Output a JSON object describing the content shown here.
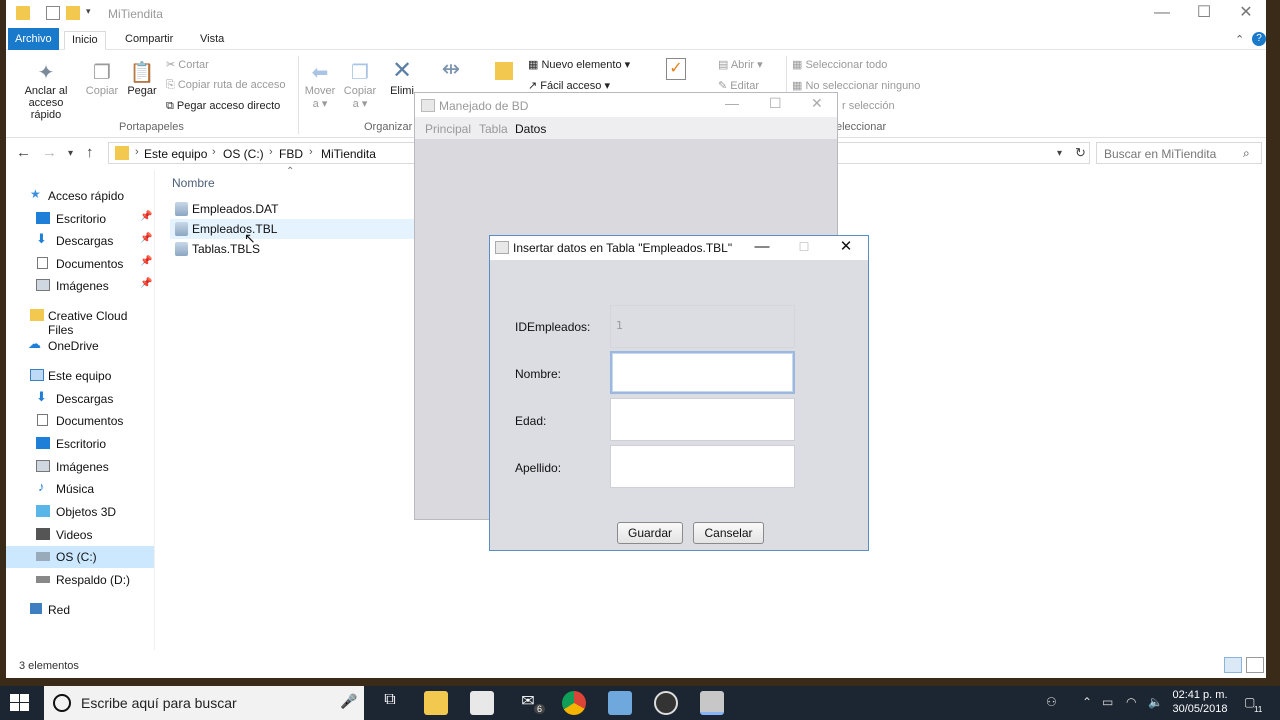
{
  "explorer": {
    "title": "MiTiendita",
    "tabs": [
      "Archivo",
      "Inicio",
      "Compartir",
      "Vista"
    ],
    "ribbon": {
      "pin_label_1": "Anclar al",
      "pin_label_2": "acceso rápido",
      "copy": "Copiar",
      "paste": "Pegar",
      "cut": "Cortar",
      "copy_path": "Copiar ruta de acceso",
      "paste_shortcut": "Pegar acceso directo",
      "group_clipboard": "Portapapeles",
      "move_1": "Mover",
      "move_2": "a ▾",
      "copy_to_1": "Copiar",
      "copy_to_2": "a ▾",
      "delete": "Elimi",
      "group_organize": "Organizar",
      "new_item": "Nuevo elemento ▾",
      "easy_access": "Fácil acceso ▾",
      "open": "Abrir ▾",
      "edit": "Editar",
      "select_all": "Seleccionar todo",
      "select_none": "No seleccionar ninguno",
      "invert_selection": "r selección",
      "group_select": "eleccionar"
    },
    "breadcrumb": [
      "Este equipo",
      "OS (C:)",
      "FBD",
      "MiTiendita"
    ],
    "search_placeholder": "Buscar en MiTiendita",
    "nav": [
      {
        "label": "Acceso rápido"
      },
      {
        "label": "Escritorio"
      },
      {
        "label": "Descargas"
      },
      {
        "label": "Documentos"
      },
      {
        "label": "Imágenes"
      },
      {
        "label": "Creative Cloud Files"
      },
      {
        "label": "OneDrive"
      },
      {
        "label": "Este equipo"
      },
      {
        "label": "Descargas"
      },
      {
        "label": "Documentos"
      },
      {
        "label": "Escritorio"
      },
      {
        "label": "Imágenes"
      },
      {
        "label": "Música"
      },
      {
        "label": "Objetos 3D"
      },
      {
        "label": "Videos"
      },
      {
        "label": "OS (C:)"
      },
      {
        "label": "Respaldo (D:)"
      },
      {
        "label": "Red"
      }
    ],
    "column_name": "Nombre",
    "files": [
      "Empleados.DAT",
      "Empleados.TBL",
      "Tablas.TBLS"
    ],
    "status": "3 elementos"
  },
  "bd_window": {
    "title": "Manejado de BD",
    "menus": [
      "Principal",
      "Tabla",
      "Datos"
    ]
  },
  "dialog": {
    "title": "Insertar datos en Tabla \"Empleados.TBL\"",
    "fields": [
      {
        "label": "IDEmpleados:",
        "value": "1"
      },
      {
        "label": "Nombre:",
        "value": ""
      },
      {
        "label": "Edad:",
        "value": ""
      },
      {
        "label": "Apellido:",
        "value": ""
      }
    ],
    "save": "Guardar",
    "cancel": "Canselar"
  },
  "taskbar": {
    "search_placeholder": "Escribe aquí para buscar",
    "time": "02:41 p. m.",
    "date": "30/05/2018",
    "mail_badge": "6",
    "notif_count": "11"
  }
}
